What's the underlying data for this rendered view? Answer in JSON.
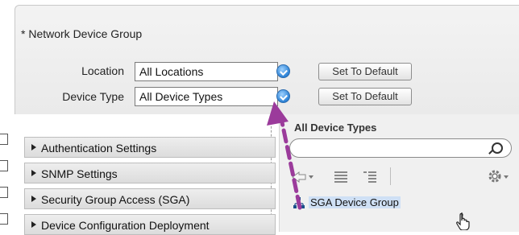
{
  "network_device_group": {
    "title": "* Network Device Group",
    "location_label": "Location",
    "location_value": "All Locations",
    "device_type_label": "Device Type",
    "device_type_value": "All Device Types",
    "set_default_label": "Set To Default"
  },
  "sections": [
    {
      "label": "Authentication Settings"
    },
    {
      "label": "SNMP Settings"
    },
    {
      "label": "Security Group Access (SGA)"
    },
    {
      "label": "Device Configuration Deployment"
    }
  ],
  "device_type_tree": {
    "title": "All Device Types",
    "search_value": "",
    "nodes": [
      {
        "label": "SGA Device Group",
        "icon": "network-group-icon"
      }
    ]
  },
  "icons": {
    "search": "search-icon",
    "back": "back-arrow-icon",
    "expand": "expand-all-icon",
    "collapse": "collapse-all-icon",
    "settings": "gear-icon",
    "cursor": "hand-cursor-icon"
  },
  "colors": {
    "annotation_arrow": "#9b3b9b",
    "selection_highlight": "#cfe0f5",
    "dropdown_arrow": "#2c82d6"
  }
}
